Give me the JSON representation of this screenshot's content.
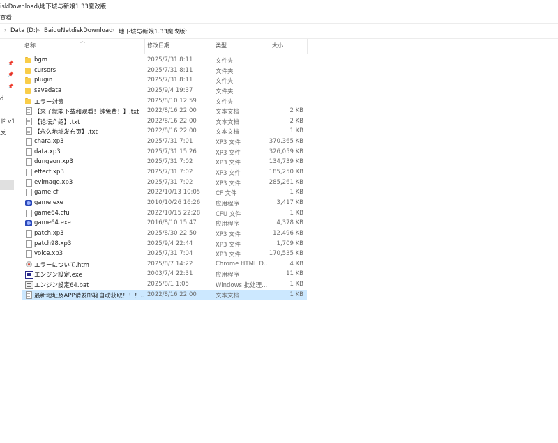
{
  "window": {
    "title": "iskDownload\\地下城与新娘1.33魔改版",
    "menu": "查看"
  },
  "address": {
    "crumbs": [
      "Data (D:)",
      "BaiduNetdiskDownload",
      "地下城与新娘1.33魔改版"
    ]
  },
  "nav": {
    "fragments": [
      "d",
      "ド v1",
      "反"
    ]
  },
  "columns": {
    "name": "名称",
    "date": "修改日期",
    "type": "类型",
    "size": "大小"
  },
  "files": [
    {
      "icon": "folder-icon",
      "name": "bgm",
      "date": "2025/7/31 8:11",
      "type": "文件夹",
      "size": ""
    },
    {
      "icon": "folder-icon",
      "name": "cursors",
      "date": "2025/7/31 8:11",
      "type": "文件夹",
      "size": ""
    },
    {
      "icon": "folder-icon",
      "name": "plugin",
      "date": "2025/7/31 8:11",
      "type": "文件夹",
      "size": ""
    },
    {
      "icon": "folder-icon",
      "name": "savedata",
      "date": "2025/9/4 19:37",
      "type": "文件夹",
      "size": ""
    },
    {
      "icon": "folder-icon",
      "name": "エラー対策",
      "date": "2025/8/10 12:59",
      "type": "文件夹",
      "size": ""
    },
    {
      "icon": "text-file-icon",
      "name": "【来了就能下载和观看！纯免费！】.txt",
      "date": "2022/8/16 22:00",
      "type": "文本文档",
      "size": "2 KB"
    },
    {
      "icon": "text-file-icon",
      "name": "【论坛介绍】.txt",
      "date": "2022/8/16 22:00",
      "type": "文本文档",
      "size": "2 KB"
    },
    {
      "icon": "text-file-icon",
      "name": "【永久地址发布页】.txt",
      "date": "2022/8/16 22:00",
      "type": "文本文档",
      "size": "1 KB"
    },
    {
      "icon": "file-icon",
      "name": "chara.xp3",
      "date": "2025/7/31 7:01",
      "type": "XP3 文件",
      "size": "370,365 KB"
    },
    {
      "icon": "file-icon",
      "name": "data.xp3",
      "date": "2025/7/31 15:26",
      "type": "XP3 文件",
      "size": "326,059 KB"
    },
    {
      "icon": "file-icon",
      "name": "dungeon.xp3",
      "date": "2025/7/31 7:02",
      "type": "XP3 文件",
      "size": "134,739 KB"
    },
    {
      "icon": "file-icon",
      "name": "effect.xp3",
      "date": "2025/7/31 7:02",
      "type": "XP3 文件",
      "size": "185,250 KB"
    },
    {
      "icon": "file-icon",
      "name": "evimage.xp3",
      "date": "2025/7/31 7:02",
      "type": "XP3 文件",
      "size": "285,261 KB"
    },
    {
      "icon": "file-icon",
      "name": "game.cf",
      "date": "2022/10/13 10:05",
      "type": "CF 文件",
      "size": "1 KB"
    },
    {
      "icon": "exe-icon",
      "name": "game.exe",
      "date": "2010/10/26 16:26",
      "type": "应用程序",
      "size": "3,417 KB"
    },
    {
      "icon": "file-icon",
      "name": "game64.cfu",
      "date": "2022/10/15 22:28",
      "type": "CFU 文件",
      "size": "1 KB"
    },
    {
      "icon": "exe-icon",
      "name": "game64.exe",
      "date": "2016/8/10 15:47",
      "type": "应用程序",
      "size": "4,378 KB"
    },
    {
      "icon": "file-icon",
      "name": "patch.xp3",
      "date": "2025/8/30 22:50",
      "type": "XP3 文件",
      "size": "12,496 KB"
    },
    {
      "icon": "file-icon",
      "name": "patch98.xp3",
      "date": "2025/9/4 22:44",
      "type": "XP3 文件",
      "size": "1,709 KB"
    },
    {
      "icon": "file-icon",
      "name": "voice.xp3",
      "date": "2025/7/31 7:04",
      "type": "XP3 文件",
      "size": "170,535 KB"
    },
    {
      "icon": "chrome-html-icon",
      "name": "エラーについて.htm",
      "date": "2025/8/7 14:22",
      "type": "Chrome HTML D...",
      "size": "4 KB"
    },
    {
      "icon": "setup-exe-icon",
      "name": "エンジン設定.exe",
      "date": "2003/7/4 22:31",
      "type": "应用程序",
      "size": "11 KB"
    },
    {
      "icon": "batch-file-icon",
      "name": "エンジン設定64.bat",
      "date": "2025/8/1 1:05",
      "type": "Windows 批处理...",
      "size": "1 KB"
    },
    {
      "icon": "text-file-icon",
      "name": "最新地址及APP请发邮箱自动获取！！！...",
      "date": "2022/8/16 22:00",
      "type": "文本文档",
      "size": "1 KB",
      "selected": true
    }
  ]
}
